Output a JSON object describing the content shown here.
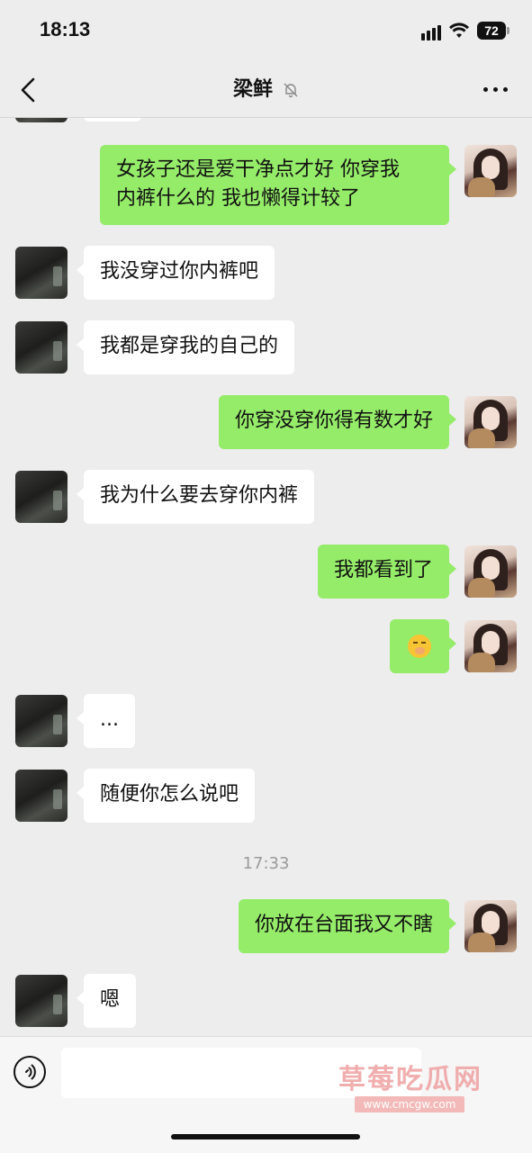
{
  "status_bar": {
    "time": "18:13",
    "battery": "72"
  },
  "nav": {
    "title": "梁鲜"
  },
  "messages": [
    {
      "side": "right",
      "text": "女孩子还是爱干净点才好 你穿我",
      "text2": "内裤什么的 我也懒得计较了"
    },
    {
      "side": "left",
      "text": "我没穿过你内裤吧"
    },
    {
      "side": "left",
      "text": "我都是穿我的自己的"
    },
    {
      "side": "right",
      "text": "你穿没穿你得有数才好"
    },
    {
      "side": "left",
      "text": "我为什么要去穿你内裤"
    },
    {
      "side": "right",
      "text": "我都看到了"
    },
    {
      "side": "right",
      "emoji": "yawning-face-emoji"
    },
    {
      "side": "left",
      "text": "..."
    },
    {
      "side": "left",
      "text": "随便你怎么说吧"
    },
    {
      "timestamp": "17:33"
    },
    {
      "side": "right",
      "text": "你放在台面我又不瞎"
    },
    {
      "side": "left",
      "text": "嗯"
    }
  ],
  "watermark": {
    "text": "草莓吃瓜网",
    "url": "www.cmcgw.com"
  },
  "colors": {
    "background": "#ededed",
    "bubble_self": "#95ec69",
    "bubble_other": "#ffffff"
  }
}
